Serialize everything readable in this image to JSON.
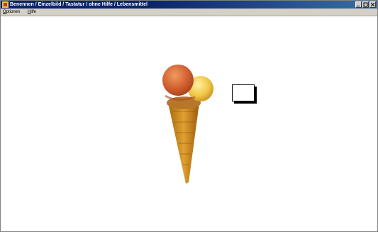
{
  "window": {
    "title": "Benennen / Einzelbild / Tastatur / ohne Hilfe / Lebensmittel"
  },
  "menu": {
    "items": [
      {
        "label": "ptionen",
        "accel": "O"
      },
      {
        "label": "ilfe",
        "accel": "H"
      }
    ]
  },
  "content": {
    "image_icon": "ice-cream-cone-icon",
    "answer_value": ""
  },
  "colors": {
    "titlebar": "#0a246a",
    "menubar": "#d4d0c8",
    "background": "#ffffff"
  }
}
